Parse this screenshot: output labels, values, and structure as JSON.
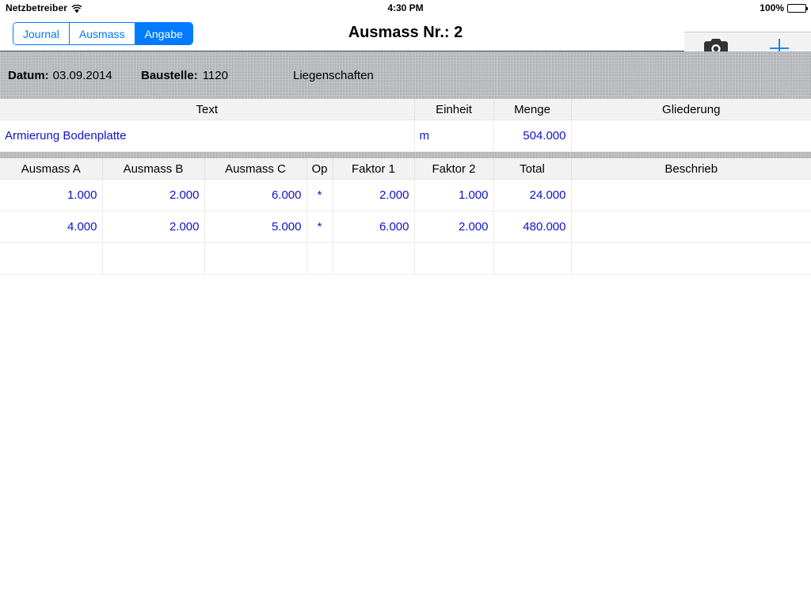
{
  "status_bar": {
    "carrier": "Netzbetreiber",
    "wifi_icon": "wifi-icon",
    "time": "4:30 PM",
    "battery_percent": "100%",
    "battery_icon": "battery-full-icon"
  },
  "nav_bar": {
    "title": "Ausmass Nr.: 2",
    "segments": [
      {
        "label": "Journal",
        "active": false
      },
      {
        "label": "Ausmass",
        "active": false
      },
      {
        "label": "Angabe",
        "active": true
      }
    ],
    "tools": [
      {
        "name": "camera-button",
        "icon": "camera-icon",
        "label": ""
      },
      {
        "name": "add-button",
        "icon": "plus-icon",
        "label": ""
      }
    ],
    "accent_color": "#007aff"
  },
  "info_bar": {
    "datum_label": "Datum:",
    "datum_value": "03.09.2014",
    "baustelle_label": "Baustelle:",
    "baustelle_value": "1120",
    "baustelle_name": "Liegenschaften"
  },
  "position_table": {
    "headers": [
      "Text",
      "Einheit",
      "Menge",
      "Gliederung"
    ],
    "rows": [
      {
        "text": "Armierung Bodenplatte",
        "einheit": "m",
        "menge": "504.000",
        "gliederung": ""
      }
    ]
  },
  "measure_table": {
    "headers": [
      "Ausmass A",
      "Ausmass B",
      "Ausmass C",
      "Op",
      "Faktor 1",
      "Faktor 2",
      "Total",
      "Beschrieb"
    ],
    "rows": [
      {
        "a": "1.000",
        "b": "2.000",
        "c": "6.000",
        "op": "*",
        "f1": "2.000",
        "f2": "1.000",
        "total": "24.000",
        "beschrieb": ""
      },
      {
        "a": "4.000",
        "b": "2.000",
        "c": "5.000",
        "op": "*",
        "f1": "6.000",
        "f2": "2.000",
        "total": "480.000",
        "beschrieb": ""
      },
      {
        "a": "",
        "b": "",
        "c": "",
        "op": "",
        "f1": "",
        "f2": "",
        "total": "",
        "beschrieb": ""
      }
    ]
  },
  "colors": {
    "accent": "#007aff",
    "value_text": "#1111cc",
    "header_bg": "#f2f2f2",
    "linen": "#b3b5b9"
  }
}
